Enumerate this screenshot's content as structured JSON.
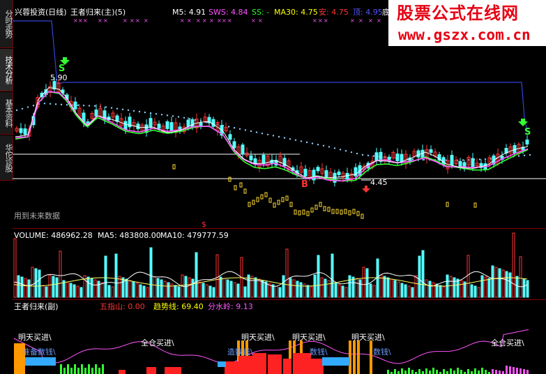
{
  "sidebar": {
    "tabs": [
      {
        "label": "分时走势",
        "active": false
      },
      {
        "label": "技术分析",
        "active": true
      },
      {
        "label": "基本资料",
        "active": false
      },
      {
        "label": "华佗诊股",
        "active": false
      }
    ]
  },
  "main_panel": {
    "title": "兴蓉投资(日线)",
    "indicator": "王者归来(主)(5)",
    "readouts": [
      {
        "label": "M5: 4.91",
        "color": "#ffffff"
      },
      {
        "label": "SWS: 4.84",
        "color": "#ff55ff"
      },
      {
        "label": "SS: -",
        "color": "#00ff00"
      },
      {
        "label": "MA30: 4.75",
        "color": "#ffff00"
      },
      {
        "label": "安: 4.75",
        "color": "#ff3333"
      },
      {
        "label": "顶: 4.95",
        "color": "#5555ff"
      },
      {
        "label": "底",
        "color": "#ffffff"
      }
    ],
    "high_label": "5.90",
    "low_label": "4.45",
    "sell_signal": "S",
    "buy_signal": "B",
    "future_note": "用到未来数据",
    "dollar_mark": "$"
  },
  "volume_panel": {
    "label": "VOLUME: 486962.28",
    "ma5": "MA5: 483808.00",
    "ma10": "MA10: 479777.59"
  },
  "sub_panel": {
    "title": "王者归来(副)",
    "readouts": [
      {
        "label": "五指山: 0.00",
        "color": "#ff3333"
      },
      {
        "label": "趋势线: 69.40",
        "color": "#ffff00"
      },
      {
        "label": "分水岭: 9.13",
        "color": "#ff55ff"
      }
    ],
    "signals": [
      {
        "text": "明天买进\\"
      },
      {
        "text": "准备数钱\\"
      },
      {
        "text": "全仓买进\\"
      },
      {
        "text": "明天买进\\"
      },
      {
        "text": "数钱\\"
      },
      {
        "text": "明天买进\\"
      },
      {
        "text": "数钱\\"
      },
      {
        "text": "明天买进\\"
      },
      {
        "text": "数钱\\"
      },
      {
        "text": "全仓买进\\"
      },
      {
        "text": "造"
      }
    ]
  },
  "watermark": {
    "title": "股票公式在线网",
    "url": "www.gszx.com.cn"
  },
  "colors": {
    "up": "#ff3333",
    "down": "#54ffff",
    "bg": "#000000",
    "grid": "#8b0000",
    "ma_white": "#ffffff",
    "ma_magenta": "#ff55ff",
    "ma_green": "#33ff33",
    "ma_blue": "#3344dd"
  }
}
